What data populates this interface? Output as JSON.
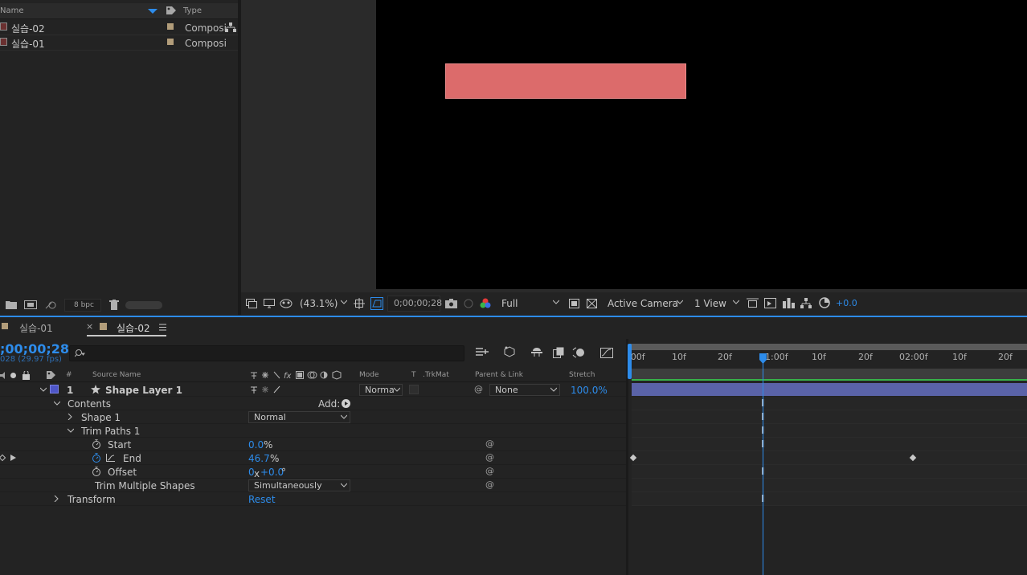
{
  "project": {
    "col_name": "Name",
    "col_type": "Type",
    "items": [
      {
        "name": "실습-02",
        "type": "Composi"
      },
      {
        "name": "실습-01",
        "type": "Composi"
      }
    ],
    "bpc": "8 bpc"
  },
  "viewer": {
    "zoom": "(43.1%)",
    "timecode": "0;00;00;28",
    "resolution": "Full",
    "camera": "Active Camera",
    "views": "1 View",
    "exposure": "+0.0",
    "layer_color": "#dc6b6b"
  },
  "timeline": {
    "tabs": [
      {
        "label": "실습-01"
      },
      {
        "label": "실습-02",
        "close": "×"
      }
    ],
    "timecode": ";00;00;28",
    "fps": "028 (29.97 fps)",
    "columns": {
      "num": "#",
      "source_name": "Source Name",
      "mode": "Mode",
      "t": "T",
      "trkmat": ".TrkMat",
      "parent": "Parent & Link",
      "stretch": "Stretch"
    },
    "layer": {
      "index": "1",
      "name": "Shape Layer 1",
      "mode": "Norma",
      "parent": "None",
      "stretch": "100.0%"
    },
    "contents": "Contents",
    "add_label": "Add:",
    "shape1": "Shape 1",
    "shape1_mode": "Normal",
    "trim_paths": "Trim Paths 1",
    "start_label": "Start",
    "start_value": "0.0",
    "start_unit": "%",
    "end_label": "End",
    "end_value": "46.7",
    "end_unit": "%",
    "offset_label": "Offset",
    "offset_rev": "0",
    "offset_x": "x",
    "offset_deg": "+0.0",
    "offset_unit": "°",
    "trim_multiple": "Trim Multiple Shapes",
    "trim_multiple_value": "Simultaneously",
    "transform": "Transform",
    "reset": "Reset",
    "ruler": [
      ":00f",
      "10f",
      "20f",
      "01:00f",
      "10f",
      "20f",
      "02:00f",
      "10f",
      "20f"
    ]
  }
}
